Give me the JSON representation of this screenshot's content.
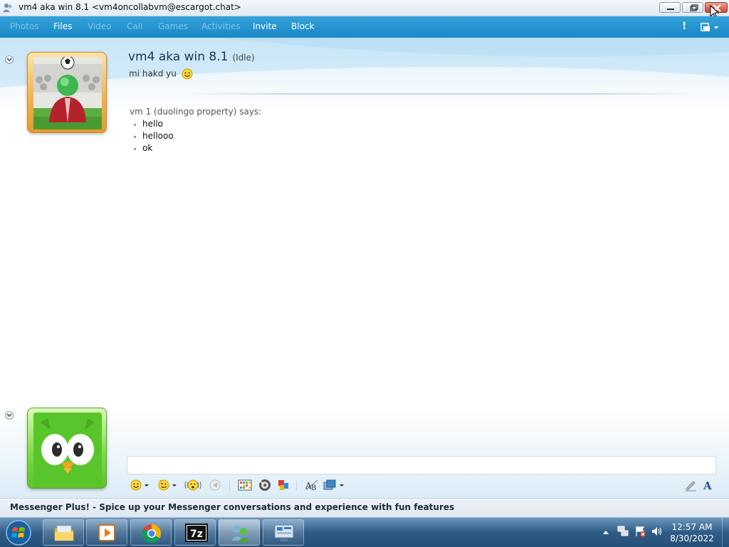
{
  "window": {
    "title": "vm4 aka win 8.1 <vm4oncollabvm@escargot.chat>"
  },
  "menu": {
    "items": [
      {
        "label": "Photos",
        "enabled": false
      },
      {
        "label": "Files",
        "enabled": true
      },
      {
        "label": "Video",
        "enabled": false
      },
      {
        "label": "Call",
        "enabled": false
      },
      {
        "label": "Games",
        "enabled": false
      },
      {
        "label": "Activities",
        "enabled": false
      },
      {
        "label": "Invite",
        "enabled": true
      },
      {
        "label": "Block",
        "enabled": true
      }
    ],
    "alert_glyph": "!"
  },
  "contact": {
    "name": "vm4 aka win 8.1",
    "status": "(Idle)",
    "personal_message": "mi hakd yu",
    "avatar": "soccer-player-avatar"
  },
  "conversation": {
    "sender_line": "vm 1 (duolingo property) says:",
    "messages": [
      "hello",
      "hellooo",
      "ok"
    ]
  },
  "self": {
    "avatar": "duolingo-owl-avatar"
  },
  "input": {
    "value": ""
  },
  "toolbar": {
    "icons": [
      "emoticon-icon",
      "wink-icon",
      "nudge-icon",
      "voice-clip-icon",
      "background-icon",
      "sound-icon",
      "games-icon",
      "font-icon",
      "send-file-icon",
      "handwriting-icon",
      "text-format-icon"
    ]
  },
  "adbar": {
    "text": "Messenger Plus! - Spice up your Messenger conversations and experience with fun features"
  },
  "taskbar": {
    "clock_time": "12:57 AM",
    "clock_date": "8/30/2022",
    "seven_zip_label": "7z"
  },
  "colors": {
    "menubar": "#2596d1",
    "accent": "#1e3550"
  }
}
